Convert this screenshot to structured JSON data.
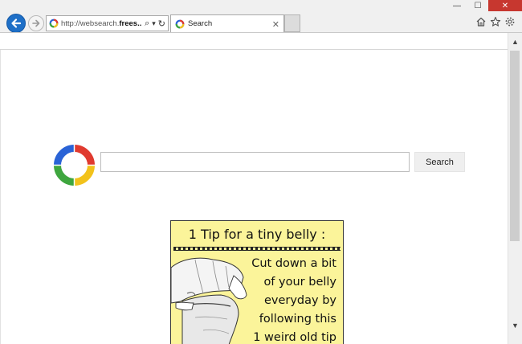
{
  "browser": {
    "address": {
      "prefix": "http://websearch.",
      "bold": "frees...",
      "search_glyph": "⌕",
      "dropdown_glyph": "▾",
      "refresh_glyph": "↻"
    },
    "tab": {
      "label": "Search",
      "close_glyph": "✕"
    },
    "window": {
      "minimize": "—",
      "maximize": "☐",
      "close": "✕"
    },
    "icons": [
      "back-arrow-icon",
      "forward-arrow-icon",
      "home-icon",
      "star-icon",
      "gear-icon"
    ]
  },
  "page": {
    "search_input": {
      "value": "",
      "placeholder": ""
    },
    "search_button_label": "Search",
    "ad": {
      "title": "1 Tip for a tiny belly :",
      "lines": [
        "Cut down a bit",
        "of your belly",
        "everyday by",
        "following this",
        "1 weird old tip"
      ]
    }
  },
  "scrollbar": {
    "up": "▲",
    "down": "▼"
  },
  "colors": {
    "back_button": "#1e6fc7",
    "ad_background": "#fbf49a",
    "logo_blue": "#2a63d6",
    "logo_red": "#e03a2f",
    "logo_yellow": "#f2c21b",
    "logo_green": "#3ea63e"
  }
}
